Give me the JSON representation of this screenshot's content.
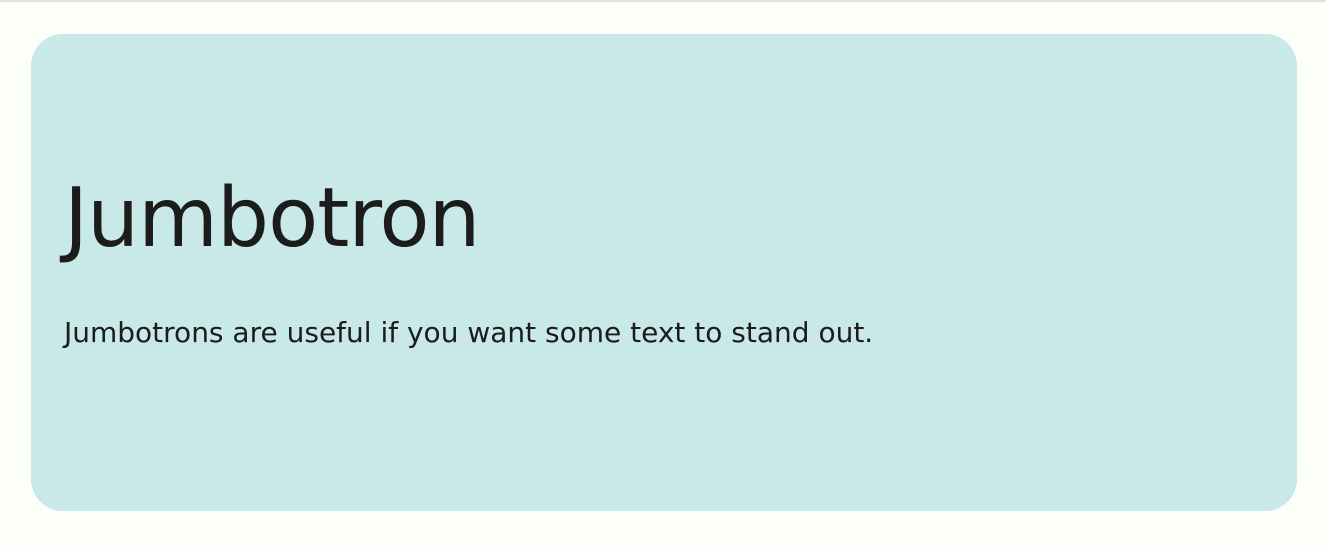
{
  "jumbotron": {
    "title": "Jumbotron",
    "text": "Jumbotrons are useful if you want some text to stand out."
  },
  "colors": {
    "page_background": "#fcfefa",
    "jumbotron_background": "#c9e8e8",
    "text": "#1c1c1c",
    "top_border": "#dfe2e0"
  }
}
